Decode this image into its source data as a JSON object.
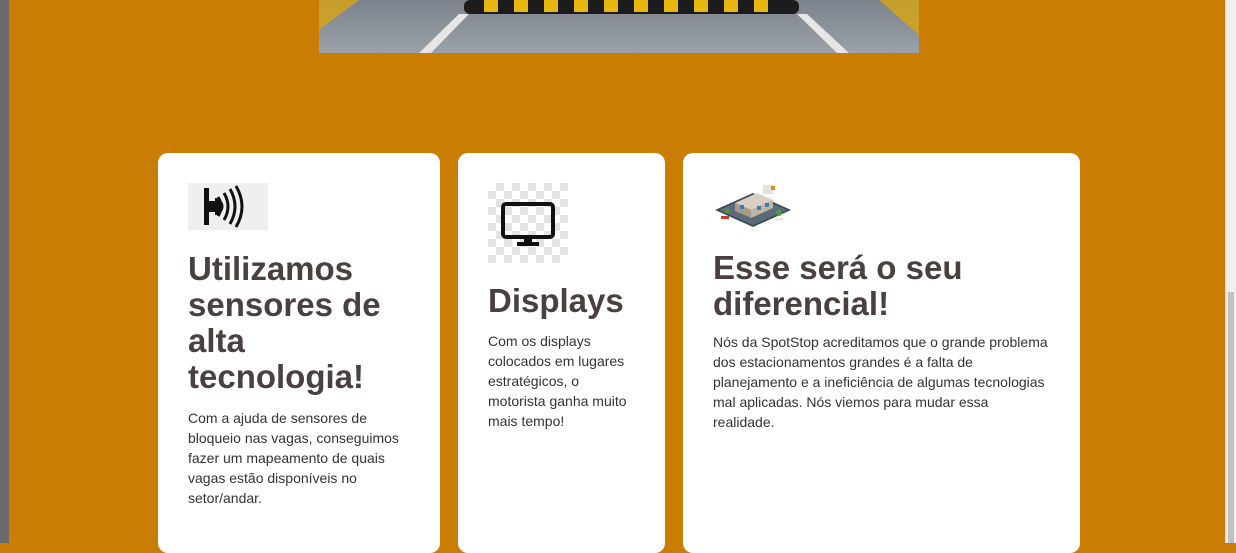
{
  "cards": [
    {
      "title": "Utilizamos sensores de alta tecnologia!",
      "text": "Com a ajuda de sensores de bloqueio nas vagas, conseguimos fazer um mapeamento de quais vagas estão disponíveis no setor/andar.",
      "icon": "proximity-sensor-icon"
    },
    {
      "title": "Displays",
      "text": "Com os displays colocados em lugares estratégicos, o motorista ganha muito mais tempo!",
      "icon": "monitor-icon"
    },
    {
      "title": "Esse será o seu diferencial!",
      "text": "Nós da SpotStop acreditamos que o grande problema dos estacionamentos grandes é a falta de planejamento e a ineficiência de algumas tecnologias mal aplicadas. Nós viemos para mudar essa realidade.",
      "icon": "parking-building-icon"
    }
  ],
  "hero": {
    "image": "parking-garage-speed-bump-photo"
  },
  "colors": {
    "background": "#c97d04",
    "card": "#ffffff",
    "heading": "#4a4040"
  }
}
